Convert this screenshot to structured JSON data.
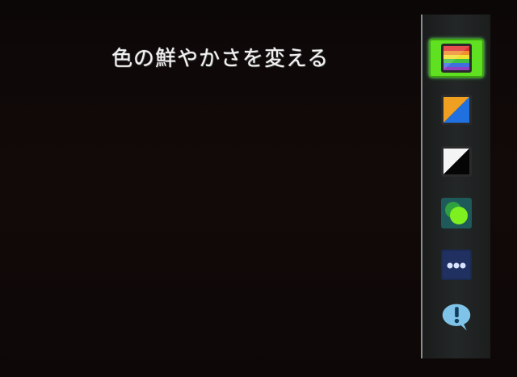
{
  "title": "色の鮮やかさを変える",
  "menu": {
    "items": [
      {
        "icon": "color-vividness-icon",
        "selected": true
      },
      {
        "icon": "color-tone-icon",
        "selected": false
      },
      {
        "icon": "contrast-icon",
        "selected": false
      },
      {
        "icon": "color-circles-icon",
        "selected": false
      },
      {
        "icon": "more-options-icon",
        "selected": false
      },
      {
        "icon": "help-info-icon",
        "selected": false
      }
    ]
  },
  "colors": {
    "background": "#120a09",
    "panel": "#242727",
    "selection": "#5fe020",
    "title_text": "#f2f2f2"
  }
}
